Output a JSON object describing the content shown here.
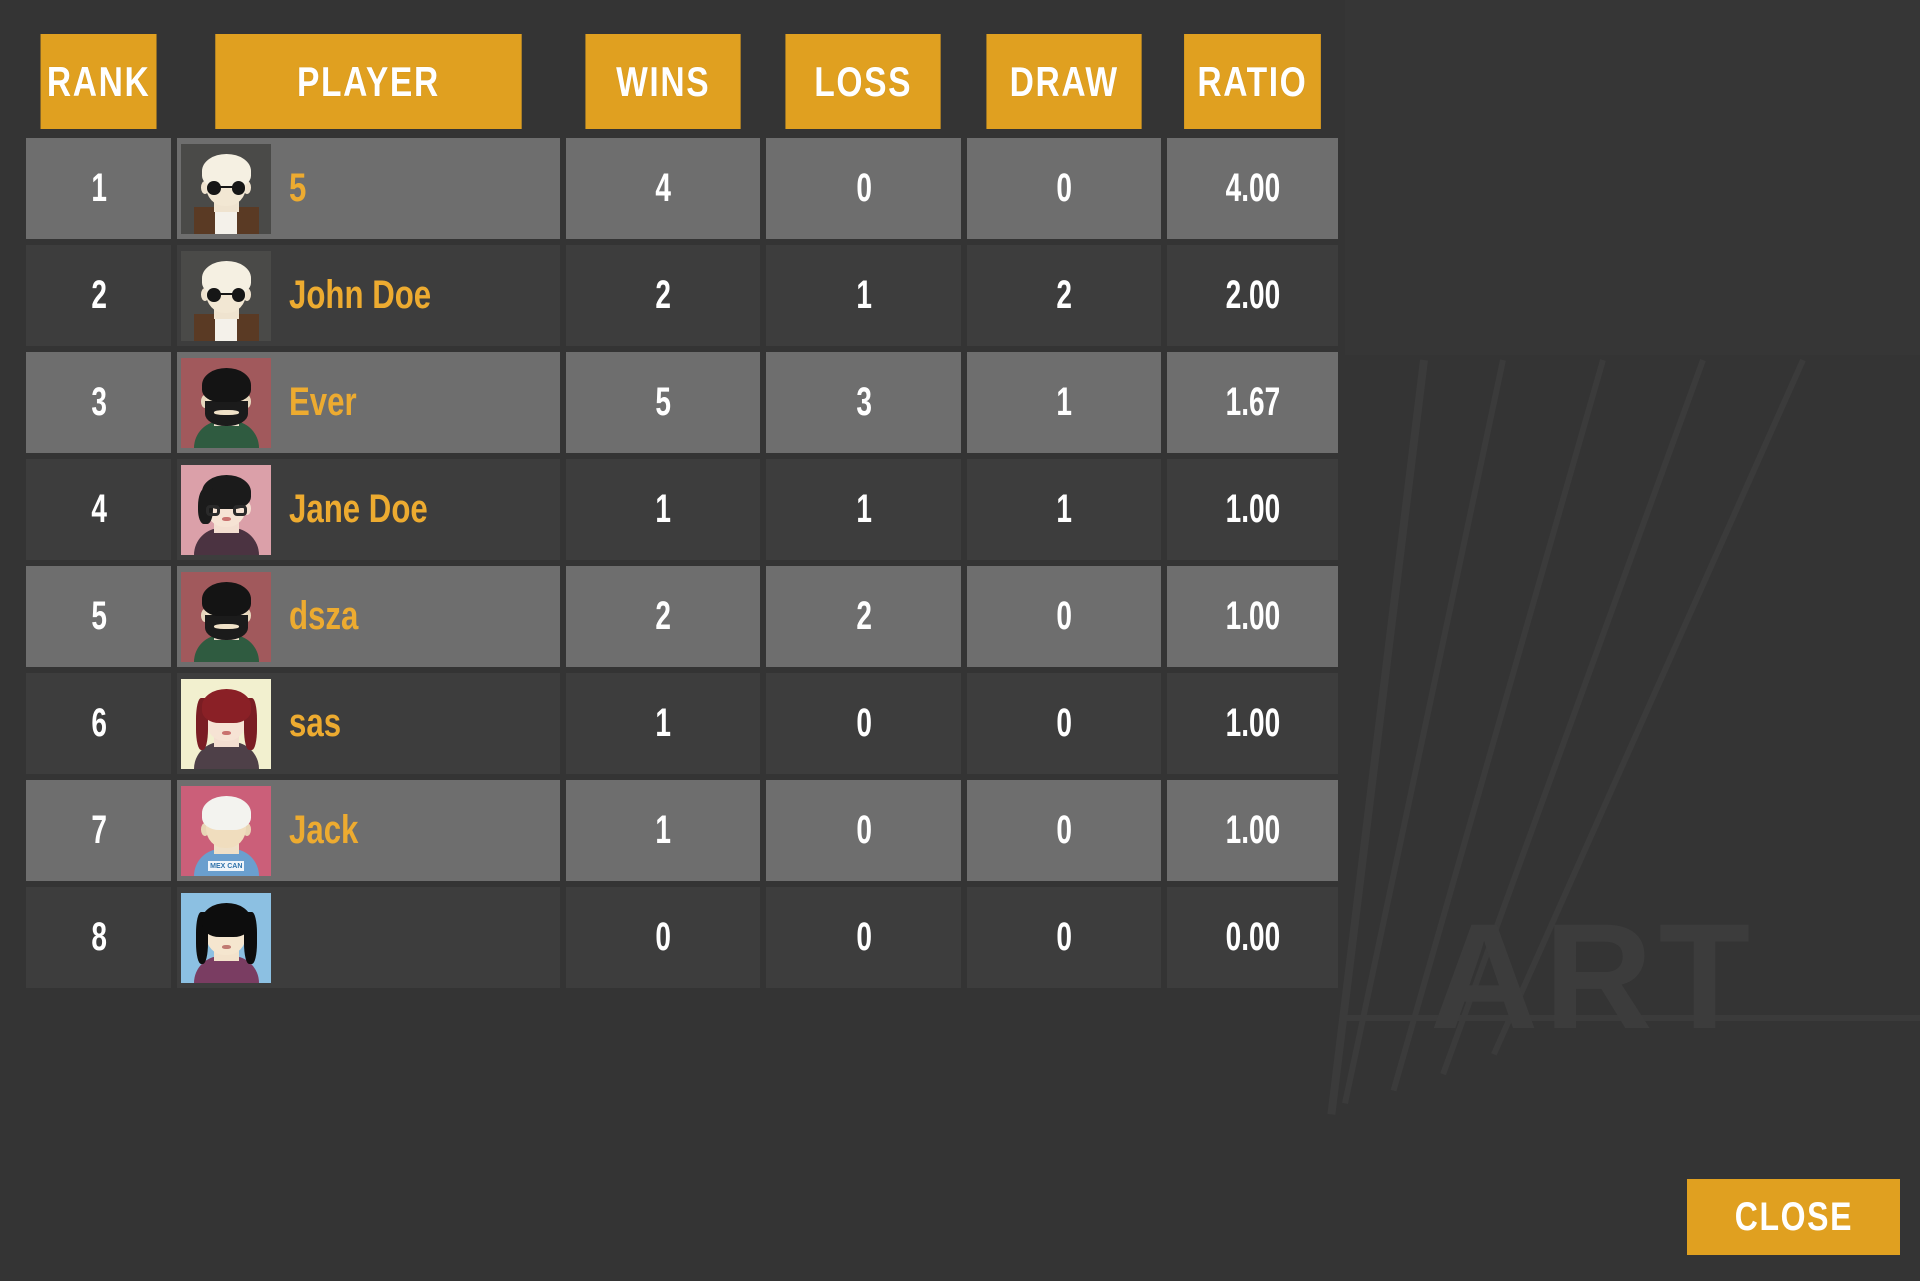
{
  "window": {
    "background_color": "#343434",
    "accent_color": "#e0a020",
    "name_color": "#edab30",
    "row_light_color": "#6e6e6e",
    "row_dark_color": "#3d3d3d",
    "decor_text": "ART"
  },
  "table": {
    "columns": [
      {
        "key": "rank",
        "label": "RANK"
      },
      {
        "key": "player",
        "label": "PLAYER"
      },
      {
        "key": "wins",
        "label": "WINS"
      },
      {
        "key": "loss",
        "label": "LOSS"
      },
      {
        "key": "draw",
        "label": "DRAW"
      },
      {
        "key": "ratio",
        "label": "RATIO"
      }
    ],
    "rows": [
      {
        "rank": "1",
        "player": "5",
        "wins": "4",
        "loss": "0",
        "draw": "0",
        "ratio": "4.00",
        "avatar": "avatar-sunglasses-white-hair"
      },
      {
        "rank": "2",
        "player": "John Doe",
        "wins": "2",
        "loss": "1",
        "draw": "2",
        "ratio": "2.00",
        "avatar": "avatar-sunglasses-white-hair"
      },
      {
        "rank": "3",
        "player": "Ever",
        "wins": "5",
        "loss": "3",
        "draw": "1",
        "ratio": "1.67",
        "avatar": "avatar-bearded-man-green-shirt"
      },
      {
        "rank": "4",
        "player": "Jane Doe",
        "wins": "1",
        "loss": "1",
        "draw": "1",
        "ratio": "1.00",
        "avatar": "avatar-woman-glasses-short-hair"
      },
      {
        "rank": "5",
        "player": "dsza",
        "wins": "2",
        "loss": "2",
        "draw": "0",
        "ratio": "1.00",
        "avatar": "avatar-bearded-man-green-shirt"
      },
      {
        "rank": "6",
        "player": "sas",
        "wins": "1",
        "loss": "0",
        "draw": "0",
        "ratio": "1.00",
        "avatar": "avatar-red-hair-woman"
      },
      {
        "rank": "7",
        "player": "Jack",
        "wins": "1",
        "loss": "0",
        "draw": "0",
        "ratio": "1.00",
        "avatar": "avatar-white-hair-blue-tshirt"
      },
      {
        "rank": "8",
        "player": "",
        "wins": "0",
        "loss": "0",
        "draw": "0",
        "ratio": "0.00",
        "avatar": "avatar-long-black-hair-woman"
      }
    ]
  },
  "footer": {
    "close_label": "CLOSE"
  },
  "avatar_shirt_text": "MEX CAN"
}
